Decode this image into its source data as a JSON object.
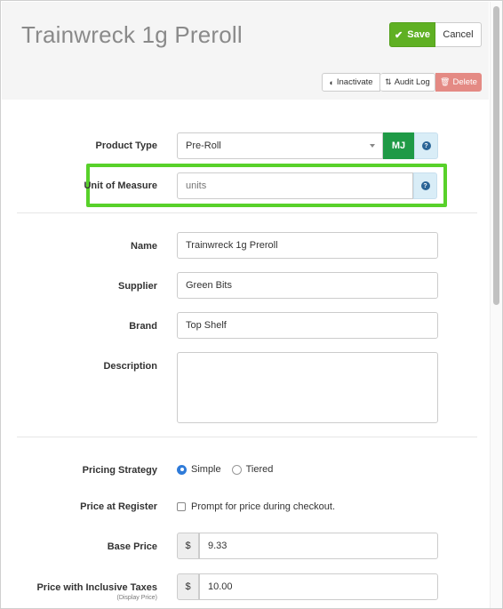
{
  "header": {
    "title": "Trainwreck 1g Preroll",
    "save_label": "Save",
    "cancel_label": "Cancel",
    "inactivate_label": "Inactivate",
    "audit_log_label": "Audit Log",
    "delete_label": "Delete"
  },
  "form": {
    "product_type": {
      "label": "Product Type",
      "value": "Pre-Roll",
      "mj_label": "MJ",
      "help": "?"
    },
    "unit_of_measure": {
      "label": "Unit of Measure",
      "placeholder": "units",
      "help": "?"
    },
    "name": {
      "label": "Name",
      "value": "Trainwreck 1g Preroll"
    },
    "supplier": {
      "label": "Supplier",
      "value": "Green Bits"
    },
    "brand": {
      "label": "Brand",
      "value": "Top Shelf"
    },
    "description": {
      "label": "Description",
      "value": ""
    },
    "pricing_strategy": {
      "label": "Pricing Strategy",
      "options": [
        "Simple",
        "Tiered"
      ],
      "selected": "Simple"
    },
    "price_at_register": {
      "label": "Price at Register",
      "checkbox_label": "Prompt for price during checkout.",
      "checked": false
    },
    "base_price": {
      "label": "Base Price",
      "currency": "$",
      "value": "9.33"
    },
    "price_inclusive": {
      "label": "Price with Inclusive Taxes",
      "sublabel": "(Display Price)",
      "currency": "$",
      "value": "10.00"
    }
  },
  "colors": {
    "save": "#5fb023",
    "delete": "#e48a84",
    "mj": "#1f9a46",
    "highlight": "#58d12a",
    "radio_selected": "#2f7bd9"
  }
}
